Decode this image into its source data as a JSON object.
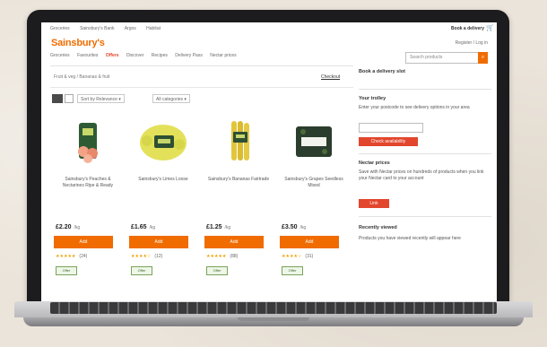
{
  "site": {
    "logo": "Sainsbury's",
    "util_links": [
      "Groceries",
      "Sainsbury's Bank",
      "Argos",
      "Habitat"
    ],
    "util_right": "Book a delivery",
    "signin": "Register / Log in",
    "search_placeholder": "Search products"
  },
  "nav": {
    "items": [
      "Groceries",
      "Favourites",
      "Offers",
      "Discover",
      "Recipes",
      "Delivery Pass",
      "Nectar prices"
    ],
    "active_index": 2
  },
  "breadcrumb": "Fruit & veg / Bananas & fruit",
  "checkout_label": "Checkout",
  "toolbar": {
    "sort_label": "Sort by",
    "sort_value": "Relevance",
    "filter_value": "All categories"
  },
  "products": [
    {
      "name": "Sainsbury's Peaches & Nectarines Ripe & Ready",
      "price": "£2.20",
      "unit": "/kg",
      "button": "Add",
      "stars": "★★★★★",
      "reviews": "(24)",
      "badge": "Offer"
    },
    {
      "name": "Sainsbury's Limes Loose",
      "price": "£1.65",
      "unit": "/kg",
      "button": "Add",
      "stars": "★★★★☆",
      "reviews": "(12)",
      "badge": "Offer"
    },
    {
      "name": "Sainsbury's Bananas Fairtrade",
      "price": "£1.25",
      "unit": "/kg",
      "button": "Add",
      "stars": "★★★★★",
      "reviews": "(88)",
      "badge": "Offer"
    },
    {
      "name": "Sainsbury's Grapes Seedless Mixed",
      "price": "£3.50",
      "unit": "/kg",
      "button": "Add",
      "stars": "★★★★☆",
      "reviews": "(31)",
      "badge": "Offer"
    }
  ],
  "sidebar": {
    "slot_heading": "Book a delivery slot",
    "trolley_heading": "Your trolley",
    "trolley_text": "Enter your postcode to see delivery options in your area",
    "trolley_button": "Check availability",
    "nectar_heading": "Nectar prices",
    "nectar_text": "Save with Nectar prices on hundreds of products when you link your Nectar card to your account",
    "nectar_button": "Link",
    "recent_heading": "Recently viewed",
    "recent_text": "Products you have viewed recently will appear here"
  },
  "colors": {
    "brand_orange": "#f06c00",
    "accent_red": "#e2462c"
  }
}
